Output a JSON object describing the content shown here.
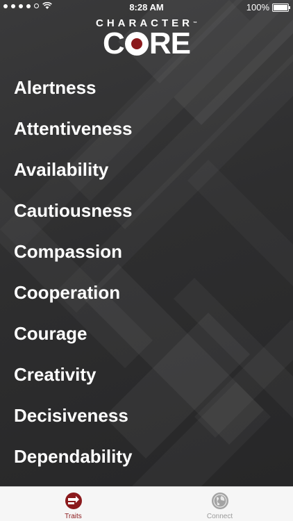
{
  "status_bar": {
    "time": "8:28 AM",
    "battery": "100%"
  },
  "logo": {
    "top_text": "CHARACTER",
    "trademark": "™",
    "main_left": "C",
    "main_right": "RE"
  },
  "traits": [
    "Alertness",
    "Attentiveness",
    "Availability",
    "Cautiousness",
    "Compassion",
    "Cooperation",
    "Courage",
    "Creativity",
    "Decisiveness",
    "Dependability"
  ],
  "tab_bar": {
    "traits_label": "Traits",
    "connect_label": "Connect",
    "active_color": "#8b1a1d",
    "inactive_color": "#9a9a9a"
  }
}
